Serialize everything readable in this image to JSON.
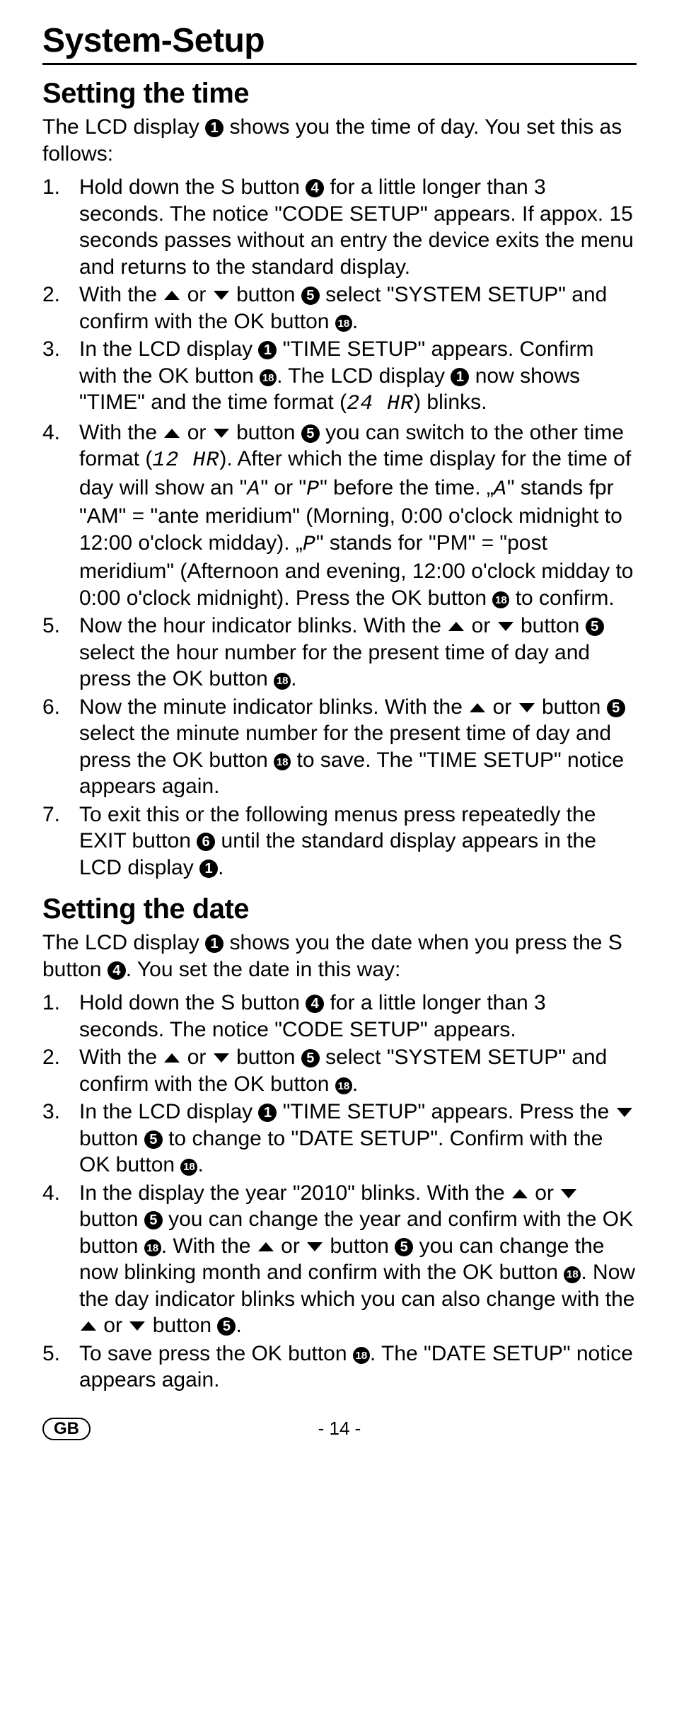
{
  "title": "System-Setup",
  "section_time": {
    "heading": "Setting the time",
    "intro_a": "The LCD display ",
    "intro_b": " shows you the time of day. You set this as follows:",
    "steps": [
      {
        "n": "1.",
        "a": "Hold down the S button ",
        "b": " for a little longer than 3 seconds. The notice \"CODE SETUP\" appears. If appox. 15 seconds passes without an entry the device exits the menu and returns to the standard display."
      },
      {
        "n": "2.",
        "a": "With the ",
        "b": " or ",
        "c": " button ",
        "d": " select \"SYSTEM SETUP\" and confirm with the OK button ",
        "e": "."
      },
      {
        "n": "3.",
        "a": "In the LCD display ",
        "b": " \"TIME SETUP\" appears. Confirm with the OK button ",
        "c": ". The LCD display ",
        "d": " now shows \"TIME\" and the time format (",
        "lcd1": "24 HR",
        "e": ") blinks."
      },
      {
        "n": "4.",
        "a": "With the ",
        "b": " or ",
        "c": " button ",
        "d": " you can switch to the other time format (",
        "lcd1": "12 HR",
        "e": "). After which the time display for the time of day will show an \"",
        "lcd2": "A",
        "f": "\" or \"",
        "lcd3": "P",
        "g": "\" before the time. „",
        "lcd4": "A",
        "h": "\" stands fpr \"AM\" = \"ante meridium\" (Morning, 0:00 o'clock midnight to 12:00 o'clock midday). „",
        "lcd5": "P",
        "i": "\" stands for \"PM\" = \"post meridium\" (Afternoon and evening, 12:00 o'clock midday to 0:00 o'clock midnight). Press the OK button ",
        "j": " to confirm."
      },
      {
        "n": "5.",
        "a": "Now the hour indicator blinks. With the ",
        "b": " or ",
        "c": " button ",
        "d": " select the hour number for the present time of day and press the OK button ",
        "e": "."
      },
      {
        "n": "6.",
        "a": "Now the minute indicator blinks. With the ",
        "b": " or ",
        "c": " button ",
        "d": " select the minute number for the present time of day and press the OK button ",
        "e": " to save. The \"TIME SETUP\" notice appears again."
      },
      {
        "n": "7.",
        "a": "To exit this or the following menus press repeatedly the EXIT button ",
        "b": " until the standard display appears in the LCD display ",
        "c": "."
      }
    ]
  },
  "section_date": {
    "heading": "Setting the date",
    "intro_a": "The LCD display ",
    "intro_b": " shows you the date when you press the S button ",
    "intro_c": ". You set the date in this way:",
    "steps": [
      {
        "n": "1.",
        "a": "Hold down the S button ",
        "b": " for a little longer than 3 seconds. The notice \"CODE SETUP\" appears."
      },
      {
        "n": "2.",
        "a": "With the ",
        "b": " or ",
        "c": " button ",
        "d": " select \"SYSTEM SETUP\" and confirm with the OK button ",
        "e": "."
      },
      {
        "n": "3.",
        "a": "In the LCD display ",
        "b": " \"TIME SETUP\" appears. Press the ",
        "c": " button ",
        "d": " to change to \"DATE SETUP\". Confirm with the OK button ",
        "e": "."
      },
      {
        "n": "4.",
        "a": "In the display the year \"2010\" blinks. With the ",
        "b": " or ",
        "c": " button ",
        "d": " you can change the year and confirm with the OK button ",
        "e": ". With the ",
        "f": " or ",
        "g": " button ",
        "h": " you can change the now blinking month and confirm with the OK button ",
        "i": ". Now the day indicator blinks which you can also change with the ",
        "j": " or ",
        "k": " button ",
        "l": "."
      },
      {
        "n": "5.",
        "a": "To save press the OK button ",
        "b": ". The \"DATE SETUP\" notice appears again."
      }
    ]
  },
  "refs": {
    "r1": "1",
    "r4": "4",
    "r5": "5",
    "r6": "6",
    "r18": "18"
  },
  "footer": {
    "badge": "GB",
    "page": "- 14 -"
  }
}
